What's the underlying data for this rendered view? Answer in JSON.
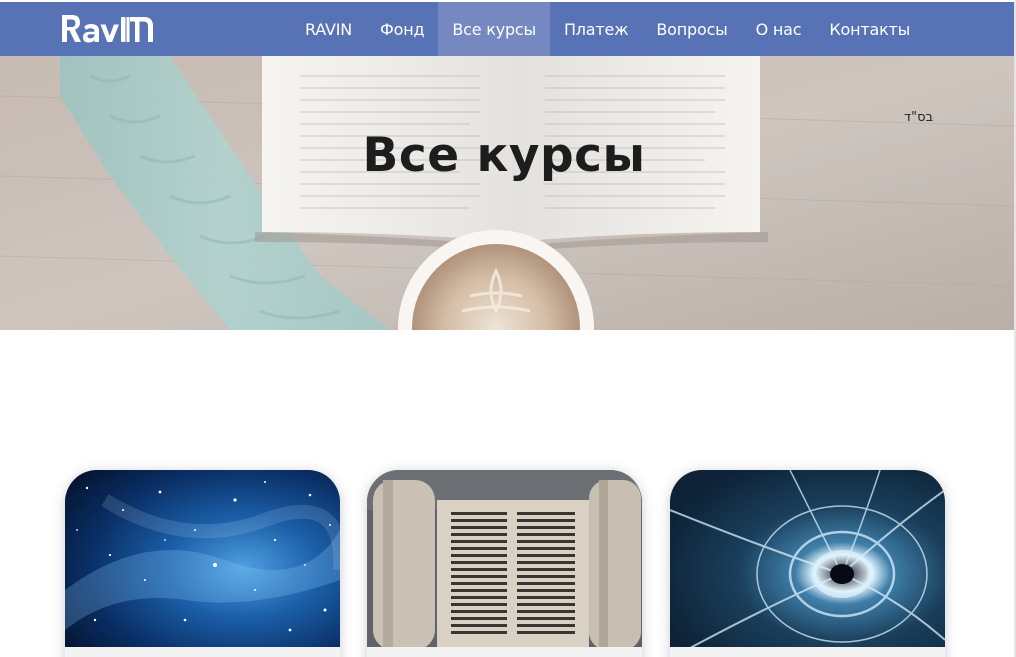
{
  "brand": {
    "logo_text": "Ravin",
    "nav_color": "#5873b5",
    "active_color": "#7588c0"
  },
  "nav": {
    "items": [
      {
        "label": "RAVIN",
        "active": false
      },
      {
        "label": "Фонд",
        "active": false
      },
      {
        "label": "Все курсы",
        "active": true
      },
      {
        "label": "Платеж",
        "active": false
      },
      {
        "label": "Вопросы",
        "active": false
      },
      {
        "label": "О нас",
        "active": false
      },
      {
        "label": "Контакты",
        "active": false
      }
    ]
  },
  "hero": {
    "title": "Все курсы",
    "hebrew_note": "בס\"ד"
  },
  "courses": [
    {
      "image": "galaxy-starfield"
    },
    {
      "image": "torah-scroll"
    },
    {
      "image": "space-tunnel"
    }
  ]
}
